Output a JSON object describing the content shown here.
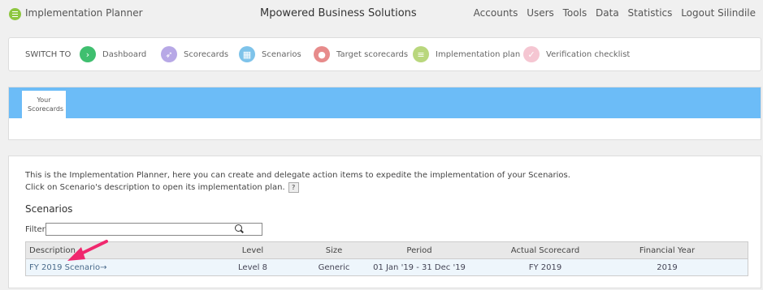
{
  "header": {
    "app_title": "Implementation Planner",
    "company": "Mpowered Business Solutions",
    "nav": [
      "Accounts",
      "Users",
      "Tools",
      "Data",
      "Statistics",
      "Logout Silindile"
    ]
  },
  "switch_to": {
    "label": "SWITCH TO",
    "items": [
      {
        "label": "Dashboard",
        "icon": "chevron-right-icon",
        "glyph": "›",
        "color": "#3fbf6f"
      },
      {
        "label": "Scorecards",
        "icon": "paper-plane-icon",
        "glyph": "➶",
        "color": "#b7a8e6"
      },
      {
        "label": "Scenarios",
        "icon": "map-icon",
        "glyph": "▦",
        "color": "#7ec3ea"
      },
      {
        "label": "Target scorecards",
        "icon": "map-pin-icon",
        "glyph": "●",
        "color": "#e78b8b"
      },
      {
        "label": "Implementation plan",
        "icon": "list-icon",
        "glyph": "≡",
        "color": "#b9d77d"
      },
      {
        "label": "Verification checklist",
        "icon": "check-icon",
        "glyph": "✓",
        "color": "#f5c6d2"
      }
    ]
  },
  "tabs": {
    "active": "Your Scorecards"
  },
  "main": {
    "intro_line1": "This is the Implementation Planner, here you can create and delegate action items to expedite the implementation of your Scenarios.",
    "intro_line2": "Click on Scenario's description to open its implementation plan.",
    "help_label": "?",
    "section_title": "Scenarios",
    "filter_label": "Filter",
    "filter_value": "",
    "table": {
      "headers": {
        "description": "Description",
        "level": "Level",
        "size": "Size",
        "period": "Period",
        "actual": "Actual Scorecard",
        "fy": "Financial Year"
      },
      "rows": [
        {
          "description": "FY 2019 Scenario→",
          "level": "Level 8",
          "size": "Generic",
          "period": "01 Jan '19 - 31 Dec '19",
          "actual": "FY 2019",
          "fy": "2019"
        }
      ]
    }
  },
  "colors": {
    "accent_arrow": "#f0286e",
    "tab_band": "#6cbcf7"
  }
}
